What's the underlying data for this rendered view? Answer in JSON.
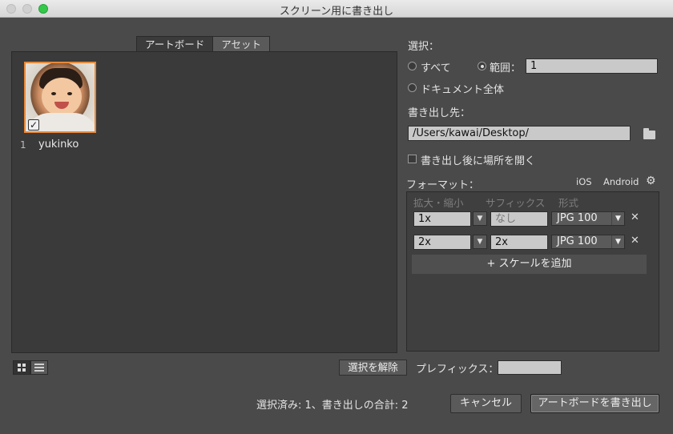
{
  "window": {
    "title": "スクリーン用に書き出し"
  },
  "tabs": [
    {
      "label": "アートボード"
    },
    {
      "label": "アセット"
    }
  ],
  "artboards": [
    {
      "number": "1",
      "name": "yukinko",
      "checked": true
    }
  ],
  "select": {
    "label": "選択：",
    "all_label": "すべて",
    "range_label": "範囲：",
    "range_value": "1",
    "whole_doc_label": "ドキュメント全体"
  },
  "export_to": {
    "label": "書き出し先：",
    "path": "/Users/kawai/Desktop/",
    "open_after_label": "書き出し後に場所を開く"
  },
  "format": {
    "label": "フォーマット：",
    "ios_label": "iOS",
    "android_label": "Android",
    "col_scale": "拡大・縮小",
    "col_suffix": "サフィックス",
    "col_format": "形式",
    "rows": [
      {
        "scale": "1x",
        "suffix": "",
        "suffix_placeholder": "なし",
        "type": "JPG 100"
      },
      {
        "scale": "2x",
        "suffix": "2x",
        "suffix_placeholder": "",
        "type": "JPG 100"
      }
    ],
    "add_scale_label": "+ スケールを追加"
  },
  "deselect_label": "選択を解除",
  "prefix": {
    "label": "プレフィックス：",
    "value": ""
  },
  "summary": "選択済み: 1、書き出しの合計: 2",
  "buttons": {
    "cancel": "キャンセル",
    "export": "アートボードを書き出し"
  },
  "colors": {
    "background": "#4a4a4a",
    "panel": "#3a3a3a",
    "selection": "#e8893a",
    "field": "#c9c9c9"
  }
}
